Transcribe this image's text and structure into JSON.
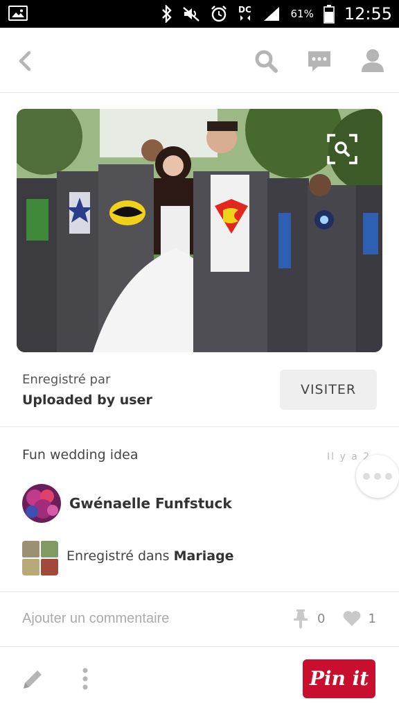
{
  "status_bar": {
    "battery_percent": "61%",
    "time": "12:55",
    "icons": [
      "gallery-icon",
      "bluetooth-icon",
      "mute-icon",
      "alarm-icon",
      "dc-icon",
      "signal-icon",
      "battery-icon"
    ]
  },
  "toolbar": {
    "icons": [
      "back-icon",
      "search-icon",
      "messages-icon",
      "profile-icon"
    ]
  },
  "pin": {
    "image_alt": "Wedding photo: bride with groom and groomsmen revealing superhero shirts",
    "zoom_icon": "visual-search-icon"
  },
  "attribution": {
    "saved_by_label": "Enregistré par",
    "uploaded_by": "Uploaded by user",
    "visit_label": "VISITER"
  },
  "details": {
    "description": "Fun wedding idea",
    "time_ago": "Il y a 2...",
    "pinner_name": "Gwénaelle Funfstuck",
    "saved_in_prefix": "Enregistré dans ",
    "board_name": "Mariage"
  },
  "comments": {
    "placeholder": "Ajouter un commentaire",
    "repin_count": "0",
    "like_count": "1"
  },
  "bottom_bar": {
    "pinit_label": "Pin it"
  },
  "colors": {
    "pinit_red": "#c8102e",
    "icon_grey": "#b5b5b5",
    "status_bar": "#000000"
  }
}
